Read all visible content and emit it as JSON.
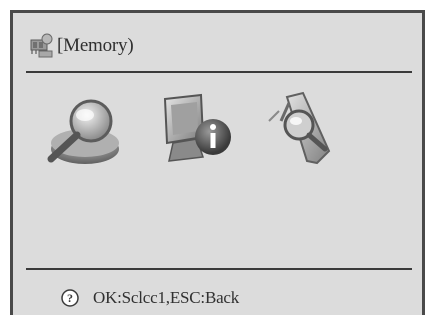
{
  "header": {
    "icon": "memory-chip-icon",
    "title": "[Memory)"
  },
  "menu": {
    "items": [
      {
        "icon": "magnifier-scan-icon"
      },
      {
        "icon": "computer-info-icon"
      },
      {
        "icon": "diagnostic-test-icon"
      }
    ]
  },
  "footer": {
    "icon": "help-icon",
    "hint": "OK:Sclcc1,ESC:Back"
  },
  "colors": {
    "background": "#dcdcdc",
    "border": "#4a4a4a",
    "text": "#303030"
  }
}
